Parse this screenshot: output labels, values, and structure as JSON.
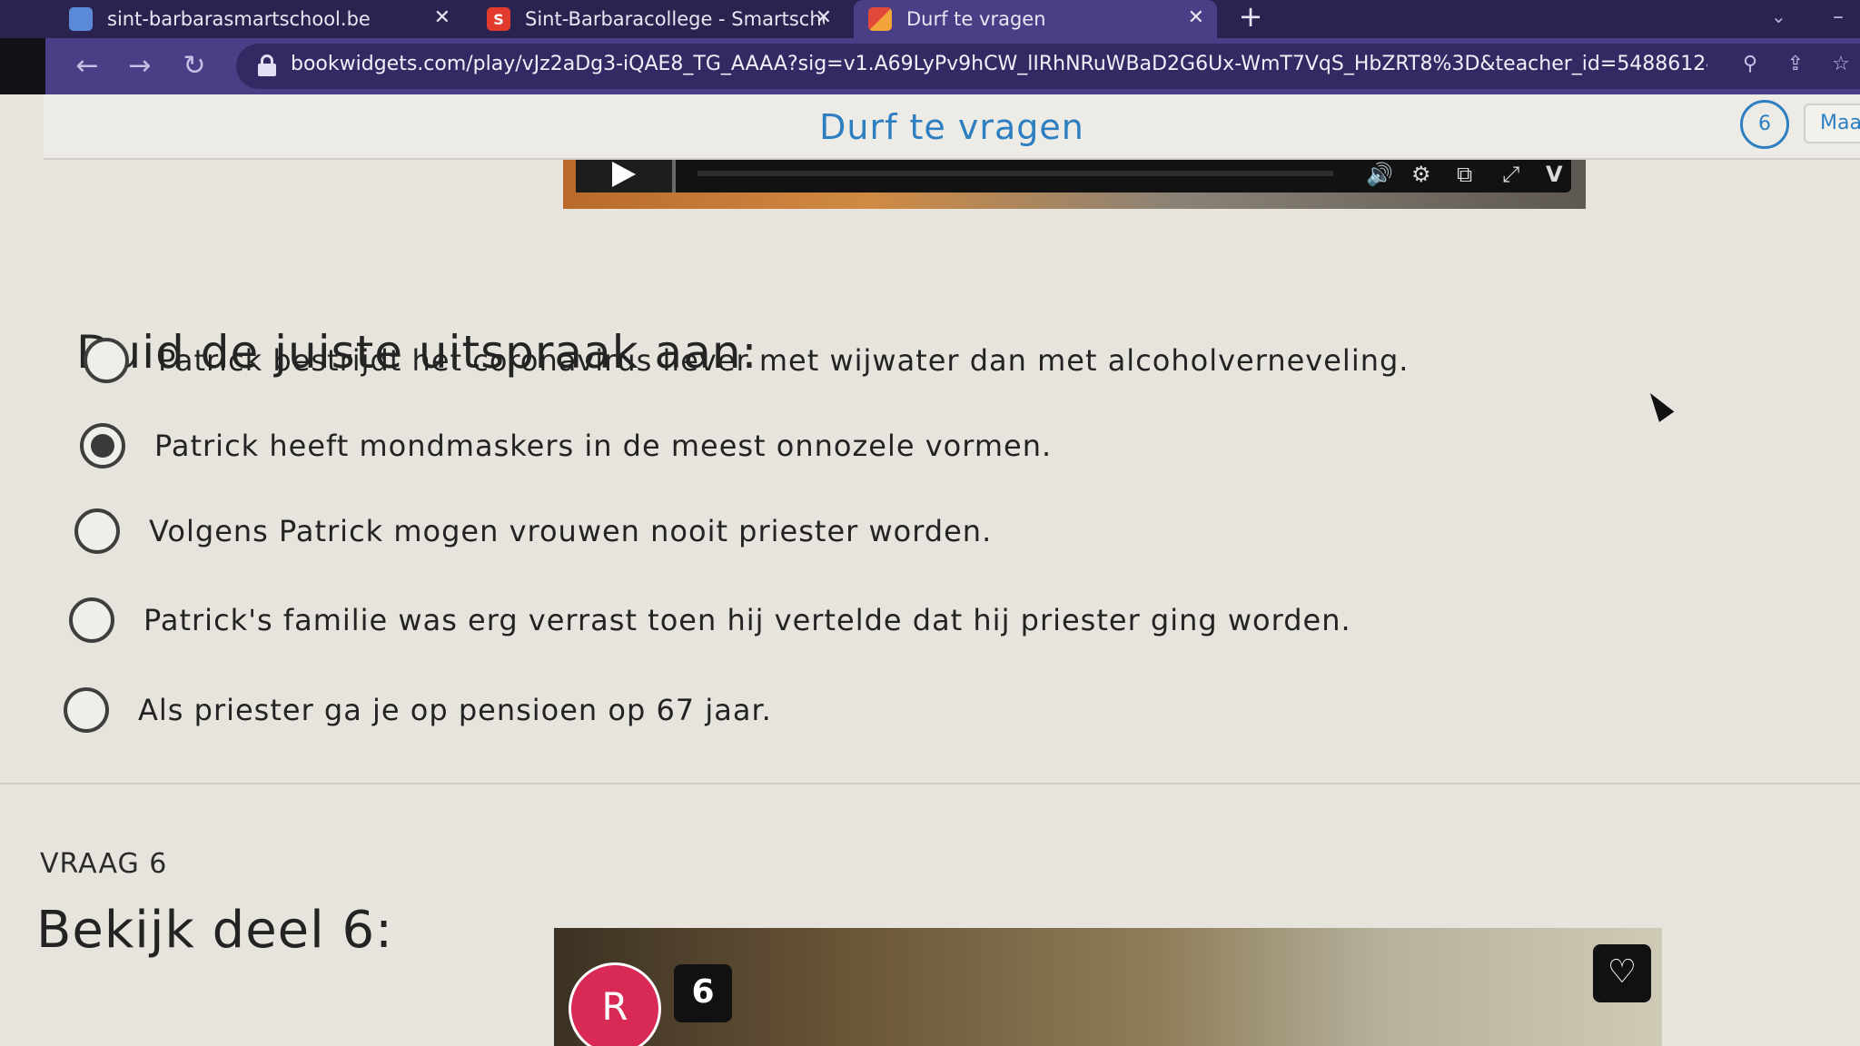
{
  "browser": {
    "tabs": [
      {
        "title": "sint-barbarasmartschool.be",
        "favicon": "smartschool"
      },
      {
        "title": "Sint-Barbaracollege - Smartscho",
        "favicon_letter": "S",
        "favicon_color": "#e23b2e"
      },
      {
        "title": "Durf te vragen",
        "favicon": "bookwidgets",
        "active": true
      }
    ],
    "new_tab_label": "+",
    "url": "bookwidgets.com/play/vJz2aDg3-iQAE8_TG_AAAA?sig=v1.A69LyPv9hCW_lIRhNRuWBaD2G6Ux-WmT7VqS_HbZRT8%3D&teacher_id=548861246753..."
  },
  "app": {
    "title": "Durf te vragen",
    "counter": "6",
    "maak_label": "Maak"
  },
  "question": {
    "prompt": "Duid de juiste uitspraak aan:",
    "options": [
      {
        "label": "Patrick bestrijdt het coronavirus liever met wijwater dan met alcoholverneveling.",
        "selected": false
      },
      {
        "label": "Patrick heeft mondmaskers in de meest onnozele vormen.",
        "selected": true
      },
      {
        "label": "Volgens Patrick mogen vrouwen nooit priester worden.",
        "selected": false
      },
      {
        "label": "Patrick's familie was erg verrast toen hij vertelde dat hij priester ging worden.",
        "selected": false
      },
      {
        "label": "Als priester ga je op pensioen op 67 jaar.",
        "selected": false
      }
    ]
  },
  "next_question": {
    "number_label": "VRAAG 6",
    "title": "Bekijk deel 6:",
    "video": {
      "avatar_letter": "R",
      "badge": "6"
    }
  },
  "colors": {
    "accent": "#2d7fc1",
    "avatar": "#d82a55",
    "chrome": "#4a3f86"
  }
}
